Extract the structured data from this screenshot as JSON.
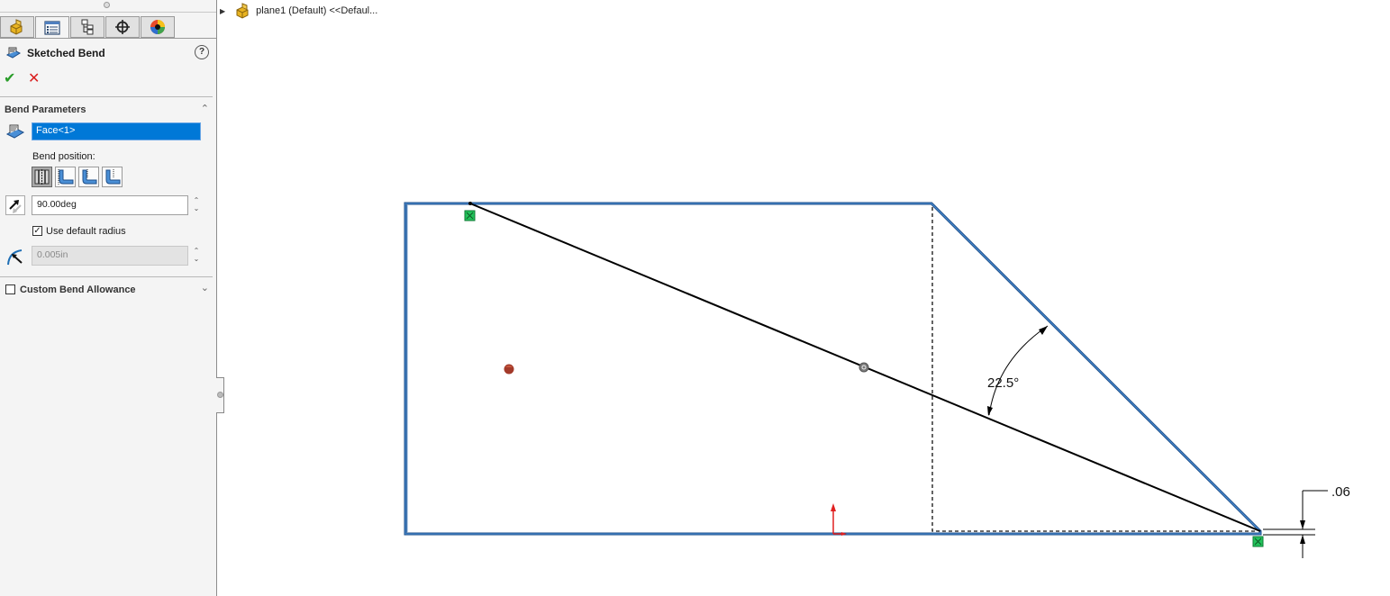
{
  "property_manager": {
    "tabs": [
      {
        "name": "feature-manager",
        "icon": "part-icon"
      },
      {
        "name": "property-manager",
        "icon": "property-manager-icon",
        "active": true
      },
      {
        "name": "configuration-manager",
        "icon": "configuration-icon"
      },
      {
        "name": "dimxpert-manager",
        "icon": "crosshair-icon"
      },
      {
        "name": "display-manager",
        "icon": "appearance-ball-icon"
      }
    ],
    "title": "Sketched Bend",
    "help_label": "?",
    "ok_label": "✔",
    "cancel_label": "✕",
    "bend_parameters": {
      "title": "Bend Parameters",
      "fixed_face": "Face<1>",
      "bend_position_label": "Bend position:",
      "bend_positions": [
        "bend-centerline",
        "material-inside",
        "material-outside",
        "bend-outside"
      ],
      "selected_bend_position": 0,
      "angle": "90.00deg",
      "use_default_radius_label": "Use default radius",
      "use_default_radius": true,
      "radius": "0.005in"
    },
    "custom_bend_allowance": {
      "title": "Custom Bend Allowance",
      "checked": false
    }
  },
  "feature_tree": {
    "item": "plane1 (Default) <<Defaul..."
  },
  "sketch": {
    "angle_dimension": "22.5°",
    "linear_dimension": ".06",
    "colors": {
      "edge": "#1f4f8a",
      "edge_highlight": "#4a8fd6",
      "sketch_line": "#000000",
      "relation_marker": "#22c25a",
      "origin": "#e02020"
    }
  }
}
